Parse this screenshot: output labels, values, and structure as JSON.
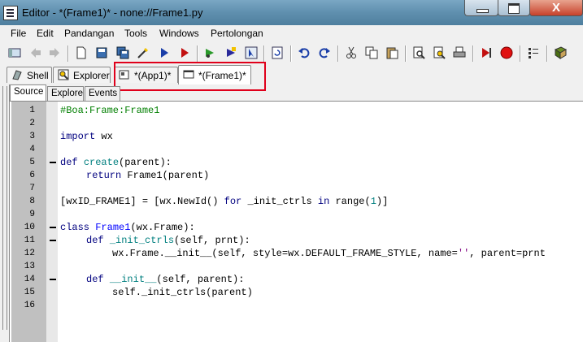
{
  "window": {
    "title": "Editor - *(Frame1)* - none://Frame1.py",
    "close_glyph": "X"
  },
  "menu": [
    "File",
    "Edit",
    "Pandangan",
    "Tools",
    "Windows",
    "Pertolongan"
  ],
  "toolbar": {
    "icons": [
      "new-panel-icon",
      "back-icon",
      "forward-icon",
      "new-icon",
      "save-icon",
      "save-all-icon",
      "edit-wand-icon",
      "run-icon",
      "debug-icon",
      "run-module-icon",
      "debug-module-icon",
      "select-icon",
      "refresh-icon",
      "undo-icon",
      "redo-icon",
      "cut-icon",
      "copy-icon",
      "paste-icon",
      "find-icon",
      "find-replace-icon",
      "print-icon",
      "bookmark-icon",
      "stop-icon",
      "breakpoint-icon",
      "help-icon"
    ]
  },
  "top_tabs": [
    {
      "label": "Shell",
      "icon": "shell-icon"
    },
    {
      "label": "Explorer",
      "icon": "explorer-icon"
    },
    {
      "label": "*(App1)*",
      "icon": "app-file-icon"
    },
    {
      "label": "*(Frame1)*",
      "icon": "frame-file-icon"
    }
  ],
  "sub_tabs": [
    "Source",
    "Explore",
    "Events"
  ],
  "code_lines": [
    {
      "n": "1",
      "fold": false
    },
    {
      "n": "2",
      "fold": false
    },
    {
      "n": "3",
      "fold": false
    },
    {
      "n": "4",
      "fold": false
    },
    {
      "n": "5",
      "fold": true
    },
    {
      "n": "6",
      "fold": false
    },
    {
      "n": "7",
      "fold": false
    },
    {
      "n": "8",
      "fold": false
    },
    {
      "n": "9",
      "fold": false
    },
    {
      "n": "10",
      "fold": true
    },
    {
      "n": "11",
      "fold": true
    },
    {
      "n": "12",
      "fold": false
    },
    {
      "n": "13",
      "fold": false
    },
    {
      "n": "14",
      "fold": true
    },
    {
      "n": "15",
      "fold": false
    },
    {
      "n": "16",
      "fold": false
    }
  ],
  "code": {
    "l1": "#Boa:Frame:Frame1",
    "l3_kw": "import",
    "l3_rest": " wx",
    "l5_kw": "def",
    "l5_fn": "create",
    "l5_rest": "(parent):",
    "l6_kw": "return",
    "l6_rest": " Frame1(parent)",
    "l8_a": "[wxID_FRAME1] = [wx.NewId() ",
    "l8_kw1": "for",
    "l8_b": " _init_ctrls ",
    "l8_kw2": "in",
    "l8_c": " range(",
    "l8_num": "1",
    "l8_d": ")]",
    "l10_kw": "class",
    "l10_cls": "Frame1",
    "l10_rest": "(wx.Frame):",
    "l11_kw": "def",
    "l11_fn": "_init_ctrls",
    "l11_rest": "(self, prnt):",
    "l12_a": "wx.Frame.__init__(self, style=wx.DEFAULT_FRAME_STYLE, name=",
    "l12_str": "''",
    "l12_b": ", parent=prnt",
    "l14_kw": "def",
    "l14_fn": "__init__",
    "l14_rest": "(self, parent):",
    "l15": "self._init_ctrls(parent)"
  },
  "colors": {
    "comment": "#007f00",
    "keyword": "#00007f",
    "function": "#007f7f",
    "highlight_box": "#e0001b"
  }
}
